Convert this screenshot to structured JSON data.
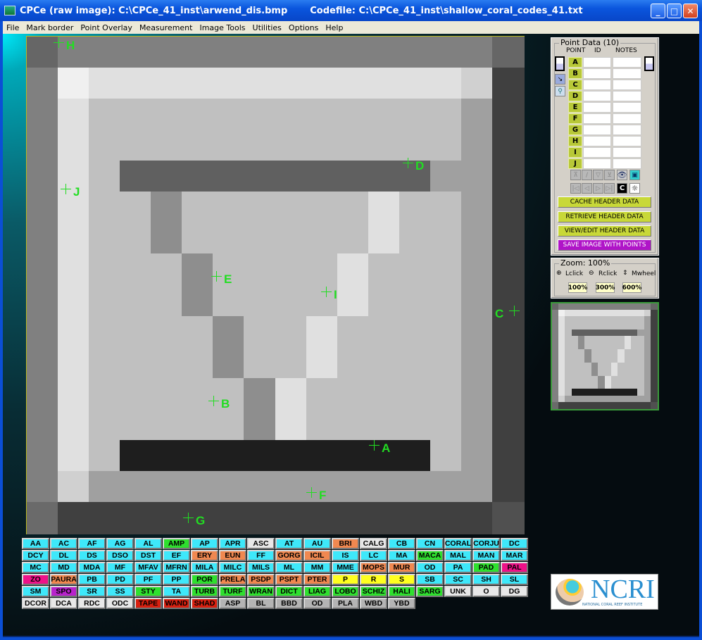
{
  "window": {
    "title": "CPCe (raw image): C:\\CPCe_41_inst\\arwend_dis.bmp",
    "codefile": "Codefile: C:\\CPCe_41_inst\\shallow_coral_codes_41.txt"
  },
  "menu": [
    "File",
    "Mark border",
    "Point Overlay",
    "Measurement",
    "Image Tools",
    "Utilities",
    "Options",
    "Help"
  ],
  "points": [
    {
      "label": "H"
    },
    {
      "label": "J"
    },
    {
      "label": "D"
    },
    {
      "label": "E"
    },
    {
      "label": "I"
    },
    {
      "label": "C"
    },
    {
      "label": "B"
    },
    {
      "label": "A"
    },
    {
      "label": "F"
    },
    {
      "label": "G"
    }
  ],
  "palette": {
    "c": "#3ee8fa",
    "g": "#2ee02e",
    "o": "#f08850",
    "w": "#e8e8e8",
    "gr": "#b4b4b4",
    "r": "#d82010",
    "p": "#ee1188",
    "pu": "#b822cc",
    "y": "#ffff20"
  },
  "codes": [
    [
      [
        "AA",
        "c"
      ],
      [
        "AC",
        "c"
      ],
      [
        "AF",
        "c"
      ],
      [
        "AG",
        "c"
      ],
      [
        "AL",
        "c"
      ],
      [
        "AMP",
        "g"
      ],
      [
        "AP",
        "c"
      ],
      [
        "APR",
        "c"
      ],
      [
        "ASC",
        "w"
      ],
      [
        "AT",
        "c"
      ],
      [
        "AU",
        "c"
      ],
      [
        "BRI",
        "o"
      ],
      [
        "CALG",
        "w"
      ],
      [
        "CB",
        "c"
      ],
      [
        "CN",
        "c"
      ],
      [
        "CORAL",
        "c"
      ],
      [
        "CORJU",
        "c"
      ],
      [
        "DC",
        "c"
      ]
    ],
    [
      [
        "DCY",
        "c"
      ],
      [
        "DL",
        "c"
      ],
      [
        "DS",
        "c"
      ],
      [
        "DSO",
        "c"
      ],
      [
        "DST",
        "c"
      ],
      [
        "EF",
        "c"
      ],
      [
        "ERY",
        "o"
      ],
      [
        "EUN",
        "o"
      ],
      [
        "FF",
        "c"
      ],
      [
        "GORG",
        "o"
      ],
      [
        "ICIL",
        "o"
      ],
      [
        "IS",
        "c"
      ],
      [
        "LC",
        "c"
      ],
      [
        "MA",
        "c"
      ],
      [
        "MACA",
        "g"
      ],
      [
        "MAL",
        "c"
      ],
      [
        "MAN",
        "c"
      ],
      [
        "MAR",
        "c"
      ]
    ],
    [
      [
        "MC",
        "c"
      ],
      [
        "MD",
        "c"
      ],
      [
        "MDA",
        "c"
      ],
      [
        "MF",
        "c"
      ],
      [
        "MFAV",
        "c"
      ],
      [
        "MFRN",
        "c"
      ],
      [
        "MILA",
        "c"
      ],
      [
        "MILC",
        "c"
      ],
      [
        "MILS",
        "c"
      ],
      [
        "ML",
        "c"
      ],
      [
        "MM",
        "c"
      ],
      [
        "MME",
        "c"
      ],
      [
        "MOPS",
        "o"
      ],
      [
        "MUR",
        "o"
      ],
      [
        "OD",
        "c"
      ],
      [
        "PA",
        "c"
      ],
      [
        "PAD",
        "g"
      ],
      [
        "PAL",
        "p"
      ]
    ],
    [
      [
        "ZO",
        "p"
      ],
      [
        "PAURA",
        "o"
      ],
      [
        "PB",
        "c"
      ],
      [
        "PD",
        "c"
      ],
      [
        "PF",
        "c"
      ],
      [
        "PP",
        "c"
      ],
      [
        "POR",
        "g"
      ],
      [
        "PRELA",
        "o"
      ],
      [
        "PSDP",
        "o"
      ],
      [
        "PSPT",
        "o"
      ],
      [
        "PTER",
        "o"
      ],
      [
        "P",
        "y"
      ],
      [
        "R",
        "y"
      ],
      [
        "S",
        "y"
      ],
      [
        "SB",
        "c"
      ],
      [
        "SC",
        "c"
      ],
      [
        "SH",
        "c"
      ],
      [
        "SL",
        "c"
      ]
    ],
    [
      [
        "SM",
        "c"
      ],
      [
        "SPO",
        "pu"
      ],
      [
        "SR",
        "c"
      ],
      [
        "SS",
        "c"
      ],
      [
        "STY",
        "g"
      ],
      [
        "TA",
        "c"
      ],
      [
        "TURB",
        "g"
      ],
      [
        "TURF",
        "g"
      ],
      [
        "WRAN",
        "g"
      ],
      [
        "DICT",
        "g"
      ],
      [
        "LIAG",
        "g"
      ],
      [
        "LOBO",
        "g"
      ],
      [
        "SCHIZ",
        "g"
      ],
      [
        "HALI",
        "g"
      ],
      [
        "SARG",
        "g"
      ],
      [
        "UNK",
        "w"
      ],
      [
        "O",
        "w"
      ],
      [
        "DG",
        "w"
      ]
    ],
    [
      [
        "DCOR",
        "w"
      ],
      [
        "DCA",
        "w"
      ],
      [
        "RDC",
        "w"
      ],
      [
        "ODC",
        "w"
      ],
      [
        "TAPE",
        "r"
      ],
      [
        "WAND",
        "r"
      ],
      [
        "SHAD",
        "r"
      ],
      [
        "ASP",
        "gr"
      ],
      [
        "BL",
        "gr"
      ],
      [
        "BBD",
        "gr"
      ],
      [
        "OD",
        "gr"
      ],
      [
        "PLA",
        "gr"
      ],
      [
        "WBD",
        "gr"
      ],
      [
        "YBD",
        "gr"
      ]
    ]
  ],
  "point_data": {
    "title": "Point Data (10)",
    "col_point": "POINT",
    "col_id": "ID",
    "col_notes": "NOTES",
    "rows": [
      "A",
      "B",
      "C",
      "D",
      "E",
      "F",
      "G",
      "H",
      "I",
      "J"
    ],
    "c_label": "C",
    "buttons": {
      "cache": "CACHE HEADER DATA",
      "retrieve": "RETRIEVE HEADER DATA",
      "view": "VIEW/EDIT HEADER DATA",
      "save": "SAVE IMAGE WITH POINTS"
    }
  },
  "zoom": {
    "title": "Zoom:  100%",
    "lclick": "Lclick",
    "rclick": "Rclick",
    "mwheel": "Mwheel",
    "b100": "100%",
    "b300": "300%",
    "b600": "600%"
  },
  "logo": {
    "text": "NCRI",
    "sub": "NATIONAL CORAL REEF INSTITUTE"
  }
}
